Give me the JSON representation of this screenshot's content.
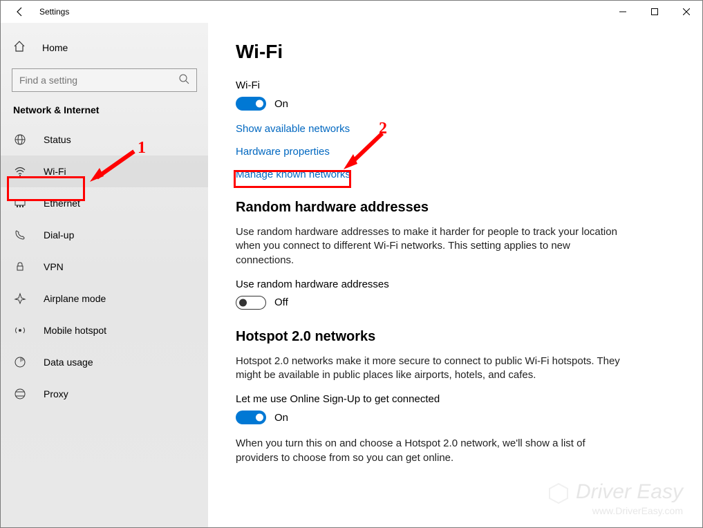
{
  "window": {
    "title": "Settings"
  },
  "sidebar": {
    "home": "Home",
    "search_placeholder": "Find a setting",
    "category": "Network & Internet",
    "items": [
      {
        "label": "Status"
      },
      {
        "label": "Wi-Fi"
      },
      {
        "label": "Ethernet"
      },
      {
        "label": "Dial-up"
      },
      {
        "label": "VPN"
      },
      {
        "label": "Airplane mode"
      },
      {
        "label": "Mobile hotspot"
      },
      {
        "label": "Data usage"
      },
      {
        "label": "Proxy"
      }
    ]
  },
  "page": {
    "title": "Wi-Fi",
    "wifi_label": "Wi-Fi",
    "wifi_toggle_state": "On",
    "links": {
      "show_available": "Show available networks",
      "hardware_props": "Hardware properties",
      "manage_known": "Manage known networks"
    },
    "random": {
      "title": "Random hardware addresses",
      "desc": "Use random hardware addresses to make it harder for people to track your location when you connect to different Wi-Fi networks. This setting applies to new connections.",
      "toggle_label": "Use random hardware addresses",
      "toggle_state": "Off"
    },
    "hotspot": {
      "title": "Hotspot 2.0 networks",
      "desc": "Hotspot 2.0 networks make it more secure to connect to public Wi-Fi hotspots. They might be available in public places like airports, hotels, and cafes.",
      "toggle_label": "Let me use Online Sign-Up to get connected",
      "toggle_state": "On",
      "desc2": "When you turn this on and choose a Hotspot 2.0 network, we'll show a list of providers to choose from so you can get online."
    }
  },
  "annotations": {
    "num1": "1",
    "num2": "2"
  },
  "watermark": {
    "main": "Driver Easy",
    "sub": "www.DriverEasy.com"
  }
}
